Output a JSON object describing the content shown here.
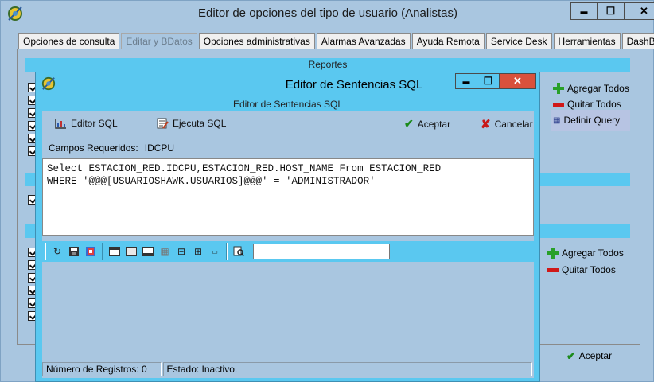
{
  "outer_window": {
    "title": "Editor de opciones del tipo de usuario (Analistas)",
    "minimize": "▬",
    "maximize": "☐",
    "close": "✕"
  },
  "tabs": [
    {
      "label": "Opciones de consulta"
    },
    {
      "label": "Editar y BDatos"
    },
    {
      "label": "Opciones administrativas"
    },
    {
      "label": "Alarmas Avanzadas"
    },
    {
      "label": "Ayuda Remota"
    },
    {
      "label": "Service Desk"
    },
    {
      "label": "Herramientas"
    },
    {
      "label": "DashBoard"
    }
  ],
  "reportes": {
    "header": "Reportes",
    "add_all": "Agregar Todos",
    "remove_all": "Quitar Todos",
    "define_query": "Definir Query"
  },
  "lower_section": {
    "add_all": "Agregar Todos",
    "remove_all": "Quitar Todos"
  },
  "accept_main": "Aceptar",
  "sql_dialog": {
    "title": "Editor de Sentencias SQL",
    "header": "Editor de Sentencias SQL",
    "editor_sql": "Editor SQL",
    "ejecuta_sql": "Ejecuta SQL",
    "aceptar": "Aceptar",
    "cancelar": "Cancelar",
    "campos_label": "Campos Requeridos:",
    "campos_value": "IDCPU",
    "sql_text": "Select ESTACION_RED.IDCPU,ESTACION_RED.HOST_NAME From ESTACION_RED\nWHERE '@@@[USUARIOSHAWK.USUARIOS]@@@' = 'ADMINISTRADOR'",
    "status_records": "Número de Registros: 0",
    "status_state": "Estado: Inactivo."
  }
}
